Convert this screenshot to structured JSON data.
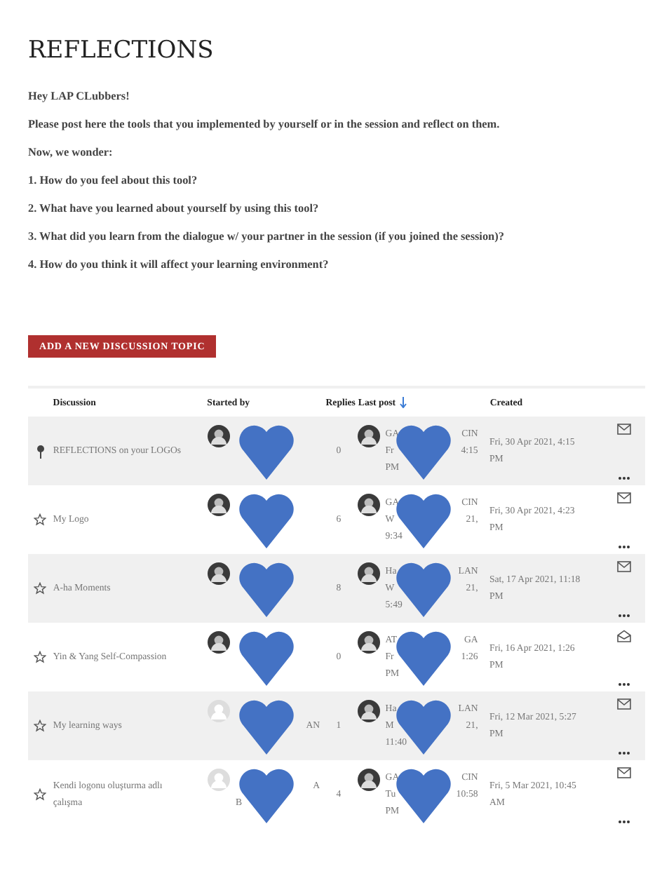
{
  "title": "REFLECTIONS",
  "intro": [
    "Hey LAP CLubbers!",
    "Please post here the tools that you implemented by yourself or in the session and reflect on them.",
    "Now, we wonder:",
    "1. How do you feel about this tool?",
    "2. What have you learned about yourself by using this tool?",
    "3. What did you learn from the dialogue w/ your partner in the session (if you joined the session)?",
    "4. How do you think it will affect your learning environment?"
  ],
  "add_button": "ADD A NEW DISCUSSION TOPIC",
  "columns": [
    "Discussion",
    "Started by",
    "Replies",
    "Last post",
    "Created"
  ],
  "rows": [
    {
      "pinned": true,
      "discussion": "REFLECTIONS on your LOGOs",
      "starter_photo": true,
      "starter": [],
      "replies": "0",
      "last_photo": true,
      "last_post": [
        {
          "l": "GA",
          "r": "CIN"
        },
        {
          "l": "Fr",
          "r": "4:15"
        },
        {
          "l": "PM"
        }
      ],
      "created": "Fri, 30 Apr 2021, 4:15 PM",
      "envelope_open": false
    },
    {
      "pinned": false,
      "discussion": "My Logo",
      "starter_photo": true,
      "starter": [],
      "replies": "6",
      "last_photo": true,
      "last_post": [
        {
          "l": "GA",
          "r": "CIN"
        },
        {
          "l": "W",
          "r": "21,"
        },
        {
          "l": "9:34"
        }
      ],
      "created": "Fri, 30 Apr 2021, 4:23 PM",
      "envelope_open": false
    },
    {
      "pinned": false,
      "discussion": "A-ha Moments",
      "starter_photo": true,
      "starter": [],
      "replies": "8",
      "last_photo": true,
      "last_post": [
        {
          "l": "Ha",
          "r": "LAN"
        },
        {
          "l": "W",
          "r": "21,"
        },
        {
          "l": "5:49"
        }
      ],
      "created": "Sat, 17 Apr 2021, 11:18 PM",
      "envelope_open": false
    },
    {
      "pinned": false,
      "discussion": "Yin & Yang Self-Compassion",
      "starter_photo": true,
      "starter": [],
      "replies": "0",
      "last_photo": true,
      "last_post": [
        {
          "l": "AT",
          "r": "GA"
        },
        {
          "l": "Fr",
          "r": "1:26"
        },
        {
          "l": "PM"
        }
      ],
      "created": "Fri, 16 Apr 2021, 1:26 PM",
      "envelope_open": true
    },
    {
      "pinned": false,
      "discussion": "My learning ways",
      "starter_photo": false,
      "starter": [
        {
          "r": "AN"
        }
      ],
      "replies": "1",
      "last_photo": true,
      "last_post": [
        {
          "l": "Ha",
          "r": "LAN"
        },
        {
          "l": "M",
          "r": "21,"
        },
        {
          "l": "11:40"
        }
      ],
      "created": "Fri, 12 Mar 2021, 5:27 PM",
      "envelope_open": false
    },
    {
      "pinned": false,
      "discussion": "Kendi logonu oluşturma adlı çalışma",
      "starter_photo": false,
      "starter": [
        {
          "r": "A"
        },
        {
          "l": "B"
        }
      ],
      "replies": "4",
      "last_photo": true,
      "last_post": [
        {
          "l": "GA",
          "r": "CIN"
        },
        {
          "l": "Tu",
          "r": "10:58"
        },
        {
          "l": "PM"
        }
      ],
      "created": "Fri, 5 Mar 2021, 10:45 AM",
      "envelope_open": false
    }
  ]
}
